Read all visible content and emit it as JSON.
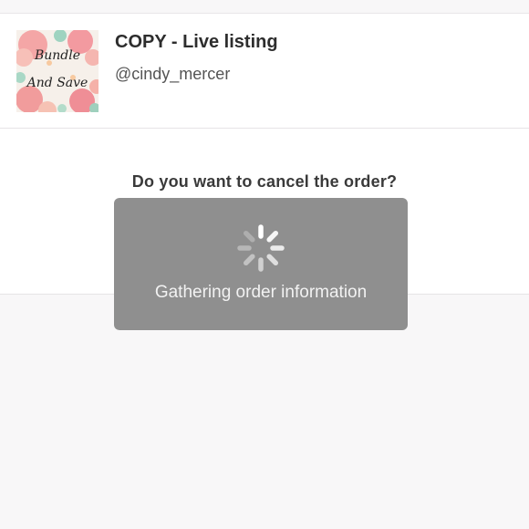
{
  "listing": {
    "title": "COPY - Live listing",
    "username": "@cindy_mercer",
    "thumbnail_text": [
      "Bundle",
      "And Save"
    ]
  },
  "dialog": {
    "question": "Do you want to cancel the order?"
  },
  "loading": {
    "message": "Gathering order information",
    "icon": "spinner-icon"
  },
  "colors": {
    "overlay": "#8f8f8f",
    "background": "#f8f7f8",
    "card": "#ffffff"
  }
}
